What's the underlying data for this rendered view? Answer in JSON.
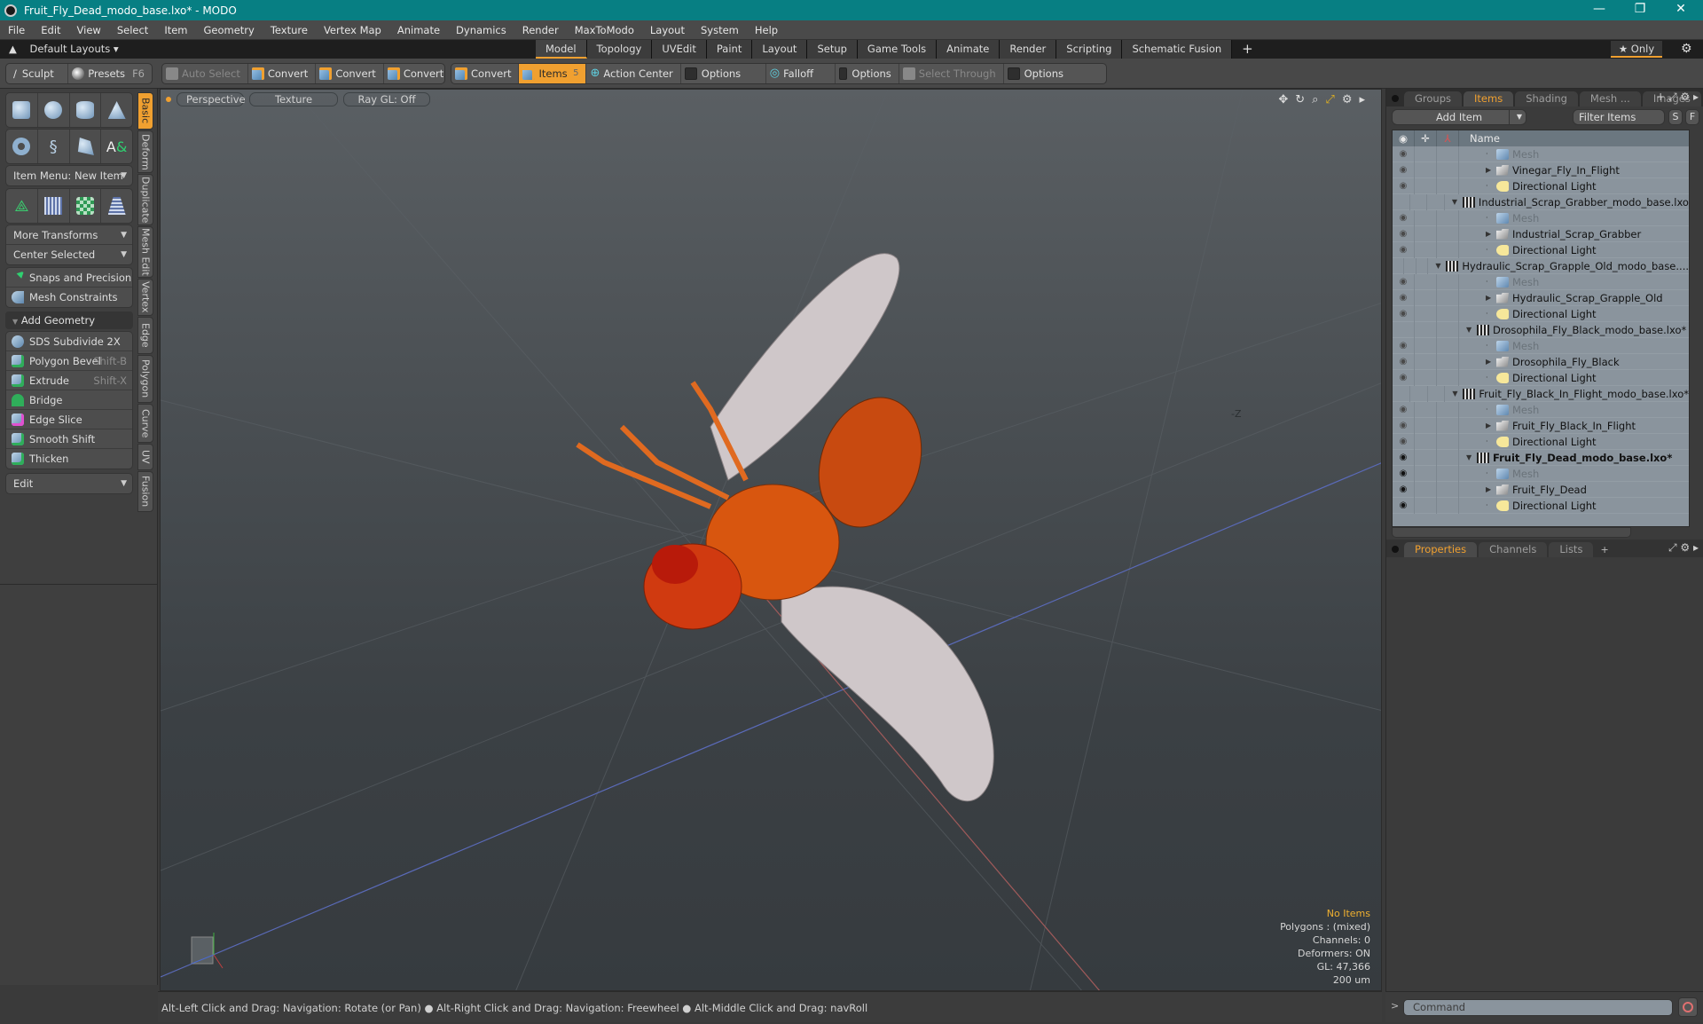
{
  "window": {
    "title": "Fruit_Fly_Dead_modo_base.lxo* - MODO",
    "minimize": "—",
    "maximize": "❐",
    "close": "✕"
  },
  "menu": [
    "File",
    "Edit",
    "View",
    "Select",
    "Item",
    "Geometry",
    "Texture",
    "Vertex Map",
    "Animate",
    "Dynamics",
    "Render",
    "MaxToModo",
    "Layout",
    "System",
    "Help"
  ],
  "layoutbar": {
    "default_layouts": "Default Layouts ▾",
    "tabs": [
      "Model",
      "Topology",
      "UVEdit",
      "Paint",
      "Layout",
      "Setup",
      "Game Tools",
      "Animate",
      "Render",
      "Scripting",
      "Schematic Fusion"
    ],
    "active_tab": "Model",
    "add": "+",
    "only": "★ Only",
    "gear": "⚙"
  },
  "toolbar": {
    "sculpt": "Sculpt",
    "presets": "Presets",
    "presets_shortcut": "F6",
    "auto_select": "Auto Select",
    "convert": "Convert",
    "items": "Items",
    "items_count": "5",
    "action_center": "Action Center",
    "options": "Options",
    "falloff": "Falloff",
    "select_through": "Select Through"
  },
  "leftpanel": {
    "item_menu": "Item Menu: New Item",
    "more_transforms": "More Transforms",
    "center_selected": "Center Selected",
    "snaps": "Snaps and Precision",
    "mesh_constraints": "Mesh Constraints",
    "add_geometry": "Add Geometry",
    "tools": [
      {
        "label": "SDS Subdivide 2X",
        "shortcut": ""
      },
      {
        "label": "Polygon Bevel",
        "shortcut": "Shift-B"
      },
      {
        "label": "Extrude",
        "shortcut": "Shift-X"
      },
      {
        "label": "Bridge",
        "shortcut": ""
      },
      {
        "label": "Edge Slice",
        "shortcut": ""
      },
      {
        "label": "Smooth Shift",
        "shortcut": ""
      },
      {
        "label": "Thicken",
        "shortcut": ""
      }
    ],
    "edit": "Edit",
    "vtabs": [
      "Basic",
      "Deform",
      "Duplicate",
      "Mesh Edit",
      "Vertex",
      "Edge",
      "Polygon",
      "Curve",
      "UV",
      "Fusion"
    ]
  },
  "viewport": {
    "view": "Perspective",
    "shading": "Texture",
    "raygl": "Ray GL: Off",
    "stats": {
      "items": "No Items",
      "polygons": "Polygons : (mixed)",
      "channels": "Channels: 0",
      "deformers": "Deformers: ON",
      "gl": "GL: 47,366",
      "scale": "200 um"
    },
    "axis_label": "-Z"
  },
  "status": "Alt-Left Click and Drag: Navigation: Rotate (or Pan) ● Alt-Right Click and Drag: Navigation: Freewheel ● Alt-Middle Click and Drag: navRoll",
  "rightpanel": {
    "tabs": [
      "Groups",
      "Items",
      "Shading",
      "Mesh ...",
      "Images"
    ],
    "active_tab": "Items",
    "add_item": "Add Item",
    "filter": "Filter Items",
    "s": "S",
    "f": "F",
    "col_name": "Name",
    "tree": [
      {
        "label": "Mesh",
        "type": "mesh",
        "indent": 2,
        "eye": true
      },
      {
        "label": "Vinegar_Fly_In_Flight",
        "type": "folder",
        "indent": 2,
        "eye": true,
        "expand": "▶"
      },
      {
        "label": "Directional Light",
        "type": "light",
        "indent": 2,
        "eye": true
      },
      {
        "label": "Industrial_Scrap_Grabber_modo_base.lxo",
        "type": "scene",
        "indent": 1,
        "eye": false,
        "expand": "▼"
      },
      {
        "label": "Mesh",
        "type": "mesh",
        "indent": 2,
        "eye": true
      },
      {
        "label": "Industrial_Scrap_Grabber",
        "type": "folder",
        "indent": 2,
        "eye": true,
        "expand": "▶"
      },
      {
        "label": "Directional Light",
        "type": "light",
        "indent": 2,
        "eye": true
      },
      {
        "label": "Hydraulic_Scrap_Grapple_Old_modo_base....",
        "type": "scene",
        "indent": 1,
        "eye": false,
        "expand": "▼"
      },
      {
        "label": "Mesh",
        "type": "mesh",
        "indent": 2,
        "eye": true
      },
      {
        "label": "Hydraulic_Scrap_Grapple_Old",
        "type": "folder",
        "indent": 2,
        "eye": true,
        "expand": "▶"
      },
      {
        "label": "Directional Light",
        "type": "light",
        "indent": 2,
        "eye": true
      },
      {
        "label": "Drosophila_Fly_Black_modo_base.lxo*",
        "type": "scene",
        "indent": 1,
        "eye": false,
        "expand": "▼"
      },
      {
        "label": "Mesh",
        "type": "mesh",
        "indent": 2,
        "eye": true
      },
      {
        "label": "Drosophila_Fly_Black",
        "type": "folder",
        "indent": 2,
        "eye": true,
        "expand": "▶"
      },
      {
        "label": "Directional Light",
        "type": "light",
        "indent": 2,
        "eye": true
      },
      {
        "label": "Fruit_Fly_Black_In_Flight_modo_base.lxo*",
        "type": "scene",
        "indent": 1,
        "eye": false,
        "expand": "▼"
      },
      {
        "label": "Mesh",
        "type": "mesh",
        "indent": 2,
        "eye": true
      },
      {
        "label": "Fruit_Fly_Black_In_Flight",
        "type": "folder",
        "indent": 2,
        "eye": true,
        "expand": "▶"
      },
      {
        "label": "Directional Light",
        "type": "light",
        "indent": 2,
        "eye": true
      },
      {
        "label": "Fruit_Fly_Dead_modo_base.lxo*",
        "type": "scene",
        "indent": 1,
        "eye": true,
        "expand": "▼",
        "bold": true,
        "dark": true
      },
      {
        "label": "Mesh",
        "type": "mesh",
        "indent": 2,
        "eye": true,
        "dark": true
      },
      {
        "label": "Fruit_Fly_Dead",
        "type": "folder",
        "indent": 2,
        "eye": true,
        "expand": "▶",
        "dark": true
      },
      {
        "label": "Directional Light",
        "type": "light",
        "indent": 2,
        "eye": true,
        "dark": true
      }
    ],
    "bottom_tabs": [
      "Properties",
      "Channels",
      "Lists"
    ],
    "bottom_active": "Properties",
    "command_placeholder": "Command",
    "prompt": ">"
  }
}
